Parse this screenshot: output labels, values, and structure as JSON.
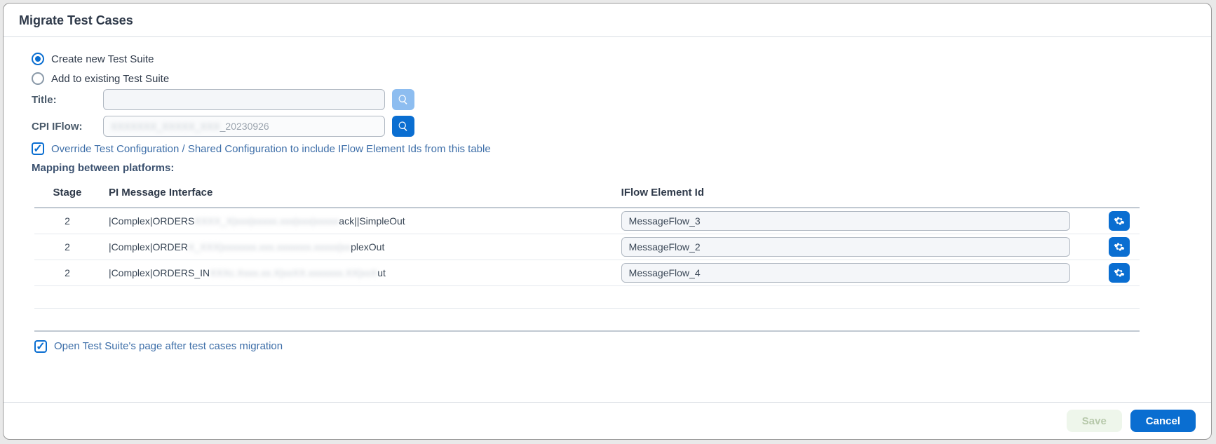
{
  "dialog": {
    "title": "Migrate Test Cases"
  },
  "mode": {
    "create_label": "Create new Test Suite",
    "add_label": "Add to existing Test Suite",
    "selected": "create"
  },
  "form": {
    "title_label": "Title:",
    "title_value": "",
    "cpi_label": "CPI IFlow:",
    "cpi_value": "_20230926",
    "cpi_blur_prefix": "XXXXXXX_XXXXX_XXX"
  },
  "override": {
    "checked": true,
    "label": "Override Test Configuration / Shared Configuration to include IFlow Element Ids from this table"
  },
  "mapping": {
    "section_title": "Mapping between platforms:",
    "columns": {
      "stage": "Stage",
      "pi": "PI Message Interface",
      "iflow": "IFlow Element Id"
    },
    "rows": [
      {
        "stage": "2",
        "pi_prefix": "|Complex|ORDERS",
        "pi_blur": "XXXX_X|xxx|xxxxx.xxx|xxx|xxxxx",
        "pi_suffix": "ack||SimpleOut",
        "iflow": "MessageFlow_3"
      },
      {
        "stage": "2",
        "pi_prefix": "|Complex|ORDER",
        "pi_blur": "X_XXX|xxxxxxx.xxx.xxxxxxx.xxxxx|xx",
        "pi_suffix": "plexOut",
        "iflow": "MessageFlow_2"
      },
      {
        "stage": "2",
        "pi_prefix": "|Complex|ORDERS_IN",
        "pi_blur": "XXXc.Xxxx.xx.X|xxXX.xxxxxxx.XX|xxX",
        "pi_suffix": "ut",
        "iflow": "MessageFlow_4"
      }
    ]
  },
  "open_after": {
    "checked": true,
    "label": "Open Test Suite's page after test cases migration"
  },
  "buttons": {
    "save": "Save",
    "cancel": "Cancel"
  },
  "icons": {
    "search": "search-icon",
    "gear": "gear-icon"
  }
}
